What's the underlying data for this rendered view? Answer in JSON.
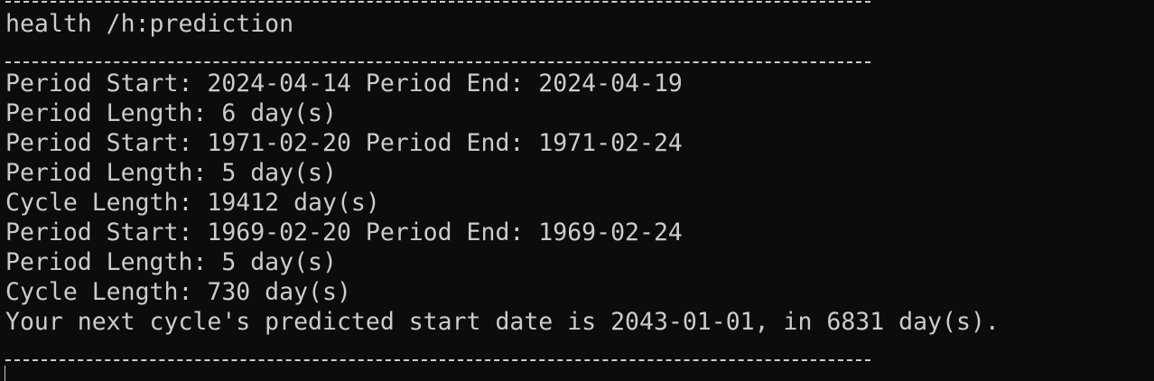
{
  "terminal": {
    "command": "health /h:prediction",
    "output": [
      "Period Start: 2024-04-14 Period End: 2024-04-19",
      "Period Length: 6 day(s)",
      "Period Start: 1971-02-20 Period End: 1971-02-24",
      "Period Length: 5 day(s)",
      "Cycle Length: 19412 day(s)",
      "Period Start: 1969-02-20 Period End: 1969-02-24",
      "Period Length: 5 day(s)",
      "Cycle Length: 730 day(s)",
      "Your next cycle's predicted start date is 2043-01-01, in 6831 day(s)."
    ]
  },
  "colors": {
    "background": "#0c0c0c",
    "foreground": "#cccccc"
  }
}
